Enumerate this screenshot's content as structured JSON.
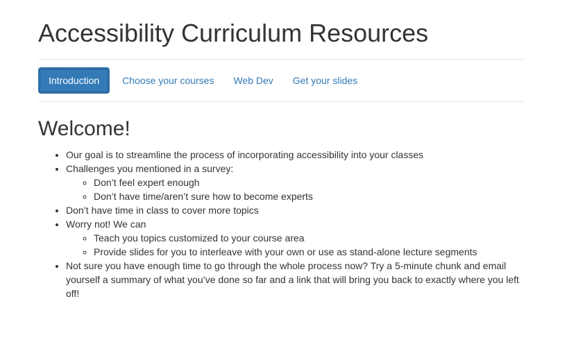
{
  "header": {
    "title": "Accessibility Curriculum Resources"
  },
  "nav": {
    "tabs": [
      {
        "label": "Introduction",
        "active": true
      },
      {
        "label": "Choose your courses",
        "active": false
      },
      {
        "label": "Web Dev",
        "active": false
      },
      {
        "label": "Get your slides",
        "active": false
      }
    ]
  },
  "main": {
    "heading": "Welcome!",
    "bullets": [
      {
        "text": "Our goal is to streamline the process of incorporating accessibility into your classes"
      },
      {
        "text": "Challenges you mentioned in a survey:",
        "sub": [
          "Don’t feel expert enough",
          "Don’t have time/aren’t sure how to become experts"
        ]
      },
      {
        "text": "Don’t have time in class to cover more topics"
      },
      {
        "text": "Worry not! We can",
        "sub": [
          "Teach you topics customized to your course area",
          "Provide slides for you to interleave with your own or use as stand-alone lecture segments"
        ]
      },
      {
        "text": "Not sure you have enough time to go through the whole process now? Try a 5-minute chunk and email yourself a summary of what you’ve done so far and a link that will bring you back to exactly where you left off!"
      }
    ]
  },
  "colors": {
    "accent": "#337ab7",
    "text": "#333333",
    "rule": "#e6e6e6"
  }
}
